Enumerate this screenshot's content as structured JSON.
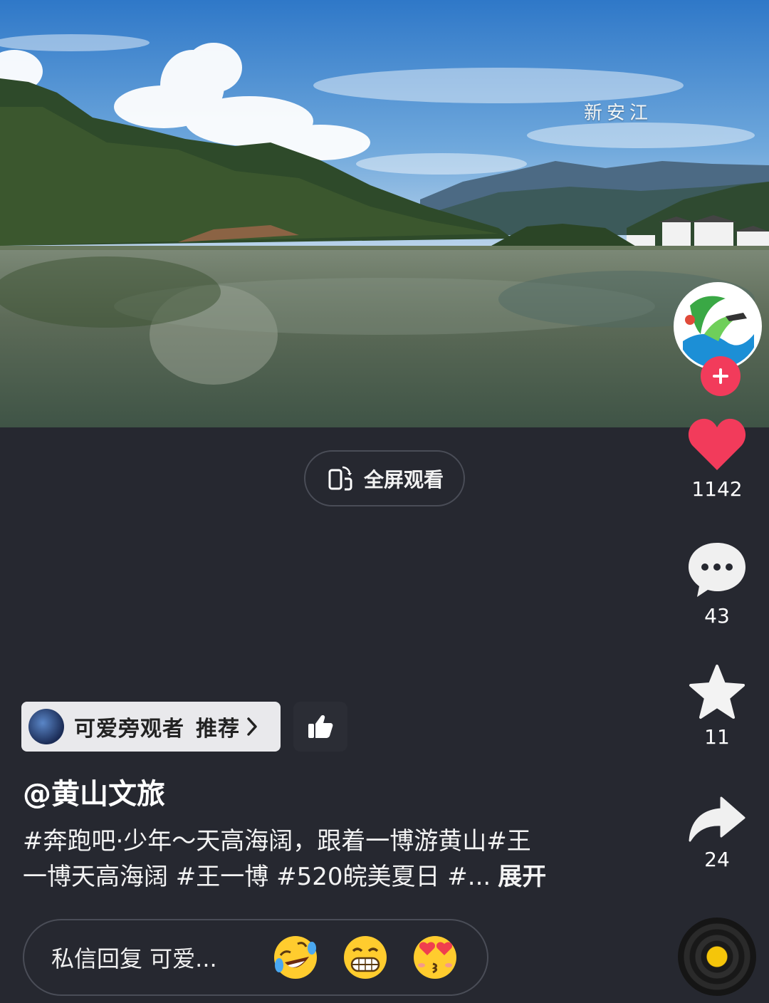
{
  "video": {
    "caption": "新安江"
  },
  "fullscreen": {
    "label": "全屏观看",
    "icon": "rotate-phone-icon"
  },
  "side_rail": {
    "avatar_icon": "huangshan-tourism-logo",
    "follow_icon": "plus-icon",
    "like": {
      "icon": "heart-icon",
      "count": "1142",
      "color": "#f23b5b"
    },
    "comment": {
      "icon": "comment-bubble-icon",
      "count": "43"
    },
    "favorite": {
      "icon": "star-icon",
      "count": "11"
    },
    "share": {
      "icon": "share-arrow-icon",
      "count": "24"
    },
    "music_icon": "music-disc-icon"
  },
  "recommend": {
    "user": "可爱旁观者",
    "label": "推荐",
    "thumb_icon": "thumbs-up-icon"
  },
  "post": {
    "author": "@黄山文旅",
    "description_line1": "#奔跑吧·少年～天高海阔，跟着一博游黄山#王",
    "description_line2": "一博天高海阔 #王一博 #520皖美夏日 #...",
    "expand": "展开"
  },
  "reply": {
    "placeholder": "私信回复 可爱...",
    "emojis": [
      "rolling-laugh-emoji",
      "grin-emoji",
      "heart-eyes-kiss-emoji"
    ]
  }
}
